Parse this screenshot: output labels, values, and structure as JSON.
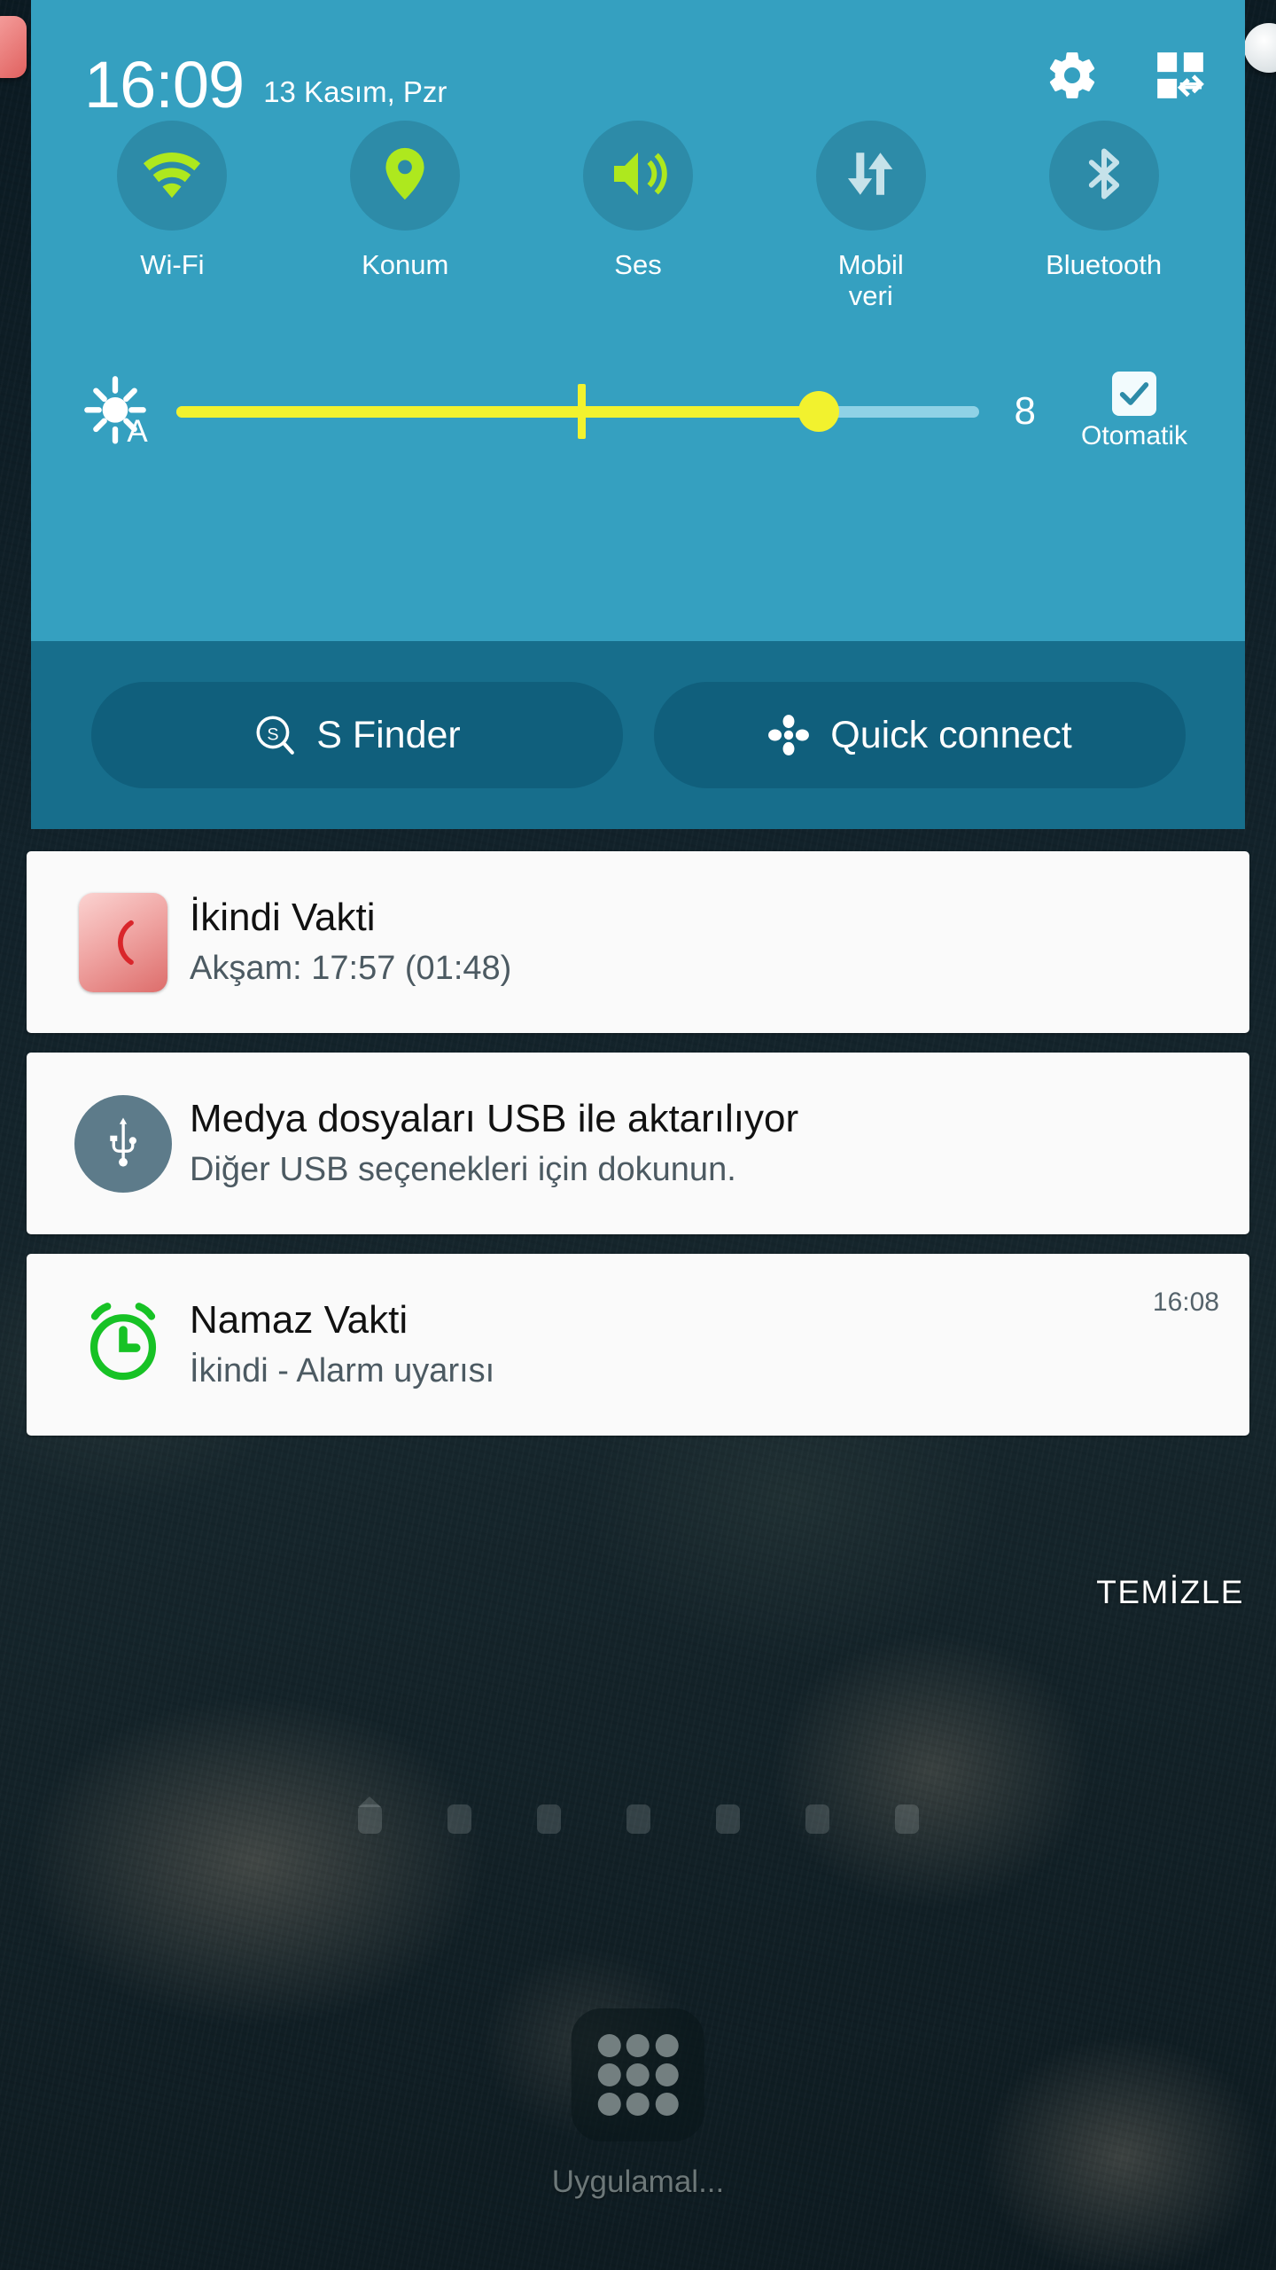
{
  "status_bar": {
    "time": "16:09",
    "date": "13 Kasım, Pzr"
  },
  "header_actions": [
    {
      "name": "settings",
      "icon": "gear-icon"
    },
    {
      "name": "edit_quick_settings",
      "icon": "quick-settings-edit-icon"
    }
  ],
  "quick_toggles": [
    {
      "label": "Wi-Fi",
      "icon": "wifi-icon",
      "active": true
    },
    {
      "label": "Konum",
      "icon": "location-pin-icon",
      "active": true
    },
    {
      "label": "Ses",
      "icon": "sound-icon",
      "active": true
    },
    {
      "label": "Mobil\nveri",
      "icon": "mobile-data-icon",
      "active": false
    },
    {
      "label": "Bluetooth",
      "icon": "bluetooth-icon",
      "active": false
    }
  ],
  "brightness": {
    "icon": "auto-brightness-icon",
    "value": "8",
    "percent": 80,
    "tick_percent": 50,
    "auto_label": "Otomatik",
    "auto_checked": true
  },
  "footer_buttons": [
    {
      "label": "S Finder",
      "icon": "s-finder-icon"
    },
    {
      "label": "Quick connect",
      "icon": "quick-connect-icon"
    }
  ],
  "notifications": [
    {
      "icon": "crescent-moon-icon",
      "title": "İkindi Vakti",
      "subtitle": "Akşam: 17:57  (01:48)",
      "time": ""
    },
    {
      "icon": "usb-icon",
      "title": "Medya dosyaları USB ile aktarılıyor",
      "subtitle": "Diğer USB seçenekleri için dokunun.",
      "time": ""
    },
    {
      "icon": "alarm-clock-icon",
      "title": "Namaz Vakti",
      "subtitle": "İkindi - Alarm uyarısı",
      "time": "16:08"
    }
  ],
  "clear_button": {
    "label": "TEMİZLE"
  },
  "home_screen": {
    "page_count": 7,
    "current_page": 1,
    "app_drawer_label": "Uygulamal...",
    "app_drawer_icon": "app-grid-icon"
  },
  "colors": {
    "panel": "#35a0c0",
    "panel_footer": "#176e8c",
    "toggle_circle": "#2d8ba8",
    "accent_active": "#aee81e",
    "accent_inactive": "#c6e2ea",
    "slider": "#f2f22e",
    "notification_bg": "#fafafa"
  }
}
